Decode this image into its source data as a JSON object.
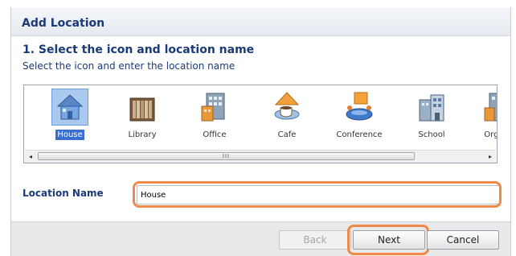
{
  "dialog": {
    "title": "Add Location"
  },
  "step": {
    "title": "1. Select the icon and location name",
    "subtitle": "Select the icon and enter the location name"
  },
  "gallery": {
    "items": [
      {
        "label": "House",
        "icon": "house-icon",
        "selected": true
      },
      {
        "label": "Library",
        "icon": "library-icon",
        "selected": false
      },
      {
        "label": "Office",
        "icon": "office-icon",
        "selected": false
      },
      {
        "label": "Cafe",
        "icon": "cafe-icon",
        "selected": false
      },
      {
        "label": "Conference",
        "icon": "conference-icon",
        "selected": false
      },
      {
        "label": "School",
        "icon": "school-icon",
        "selected": false
      },
      {
        "label": "Organi",
        "icon": "organization-icon",
        "selected": false
      }
    ],
    "scroll_left": "◂",
    "scroll_right": "▸",
    "thumb_grip": "III"
  },
  "location_name": {
    "label": "Location Name",
    "value": "House"
  },
  "buttons": {
    "back": "Back",
    "next": "Next",
    "cancel": "Cancel"
  },
  "colors": {
    "title": "#1b3a78",
    "highlight": "#ef8a48",
    "selection": "#3a6fd0"
  }
}
